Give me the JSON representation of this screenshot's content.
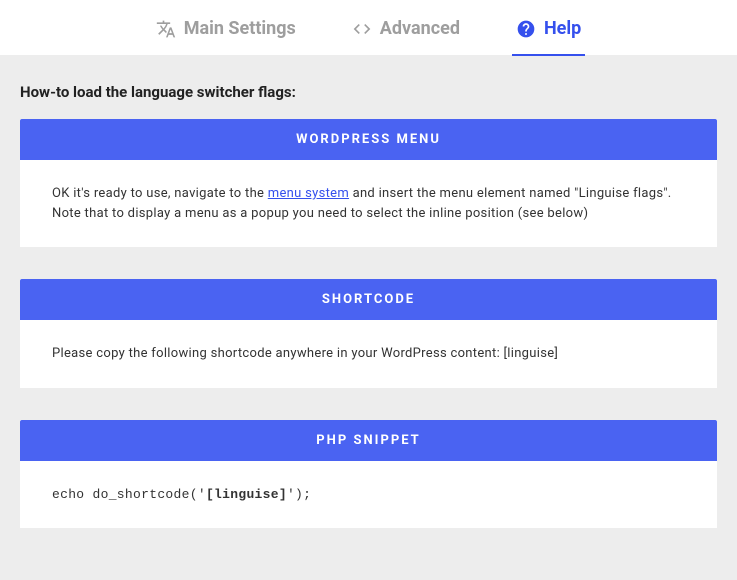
{
  "tabs": {
    "main": "Main Settings",
    "advanced": "Advanced",
    "help": "Help"
  },
  "intro": "How-to load the language switcher flags:",
  "sections": {
    "wp": {
      "title": "WORDPRESS MENU",
      "body_pre": "OK it's ready to use, navigate to the ",
      "link": "menu system",
      "body_post": " and insert the menu element named \"Linguise flags\". Note that to display a menu as a popup you need to select the inline position (see below)"
    },
    "shortcode": {
      "title": "SHORTCODE",
      "body": "Please copy the following shortcode anywhere in your WordPress content: [linguise]"
    },
    "php": {
      "title": "PHP SNIPPET",
      "code_pre": "echo do_shortcode('",
      "code_bold": "[linguise]",
      "code_post": "');"
    }
  }
}
